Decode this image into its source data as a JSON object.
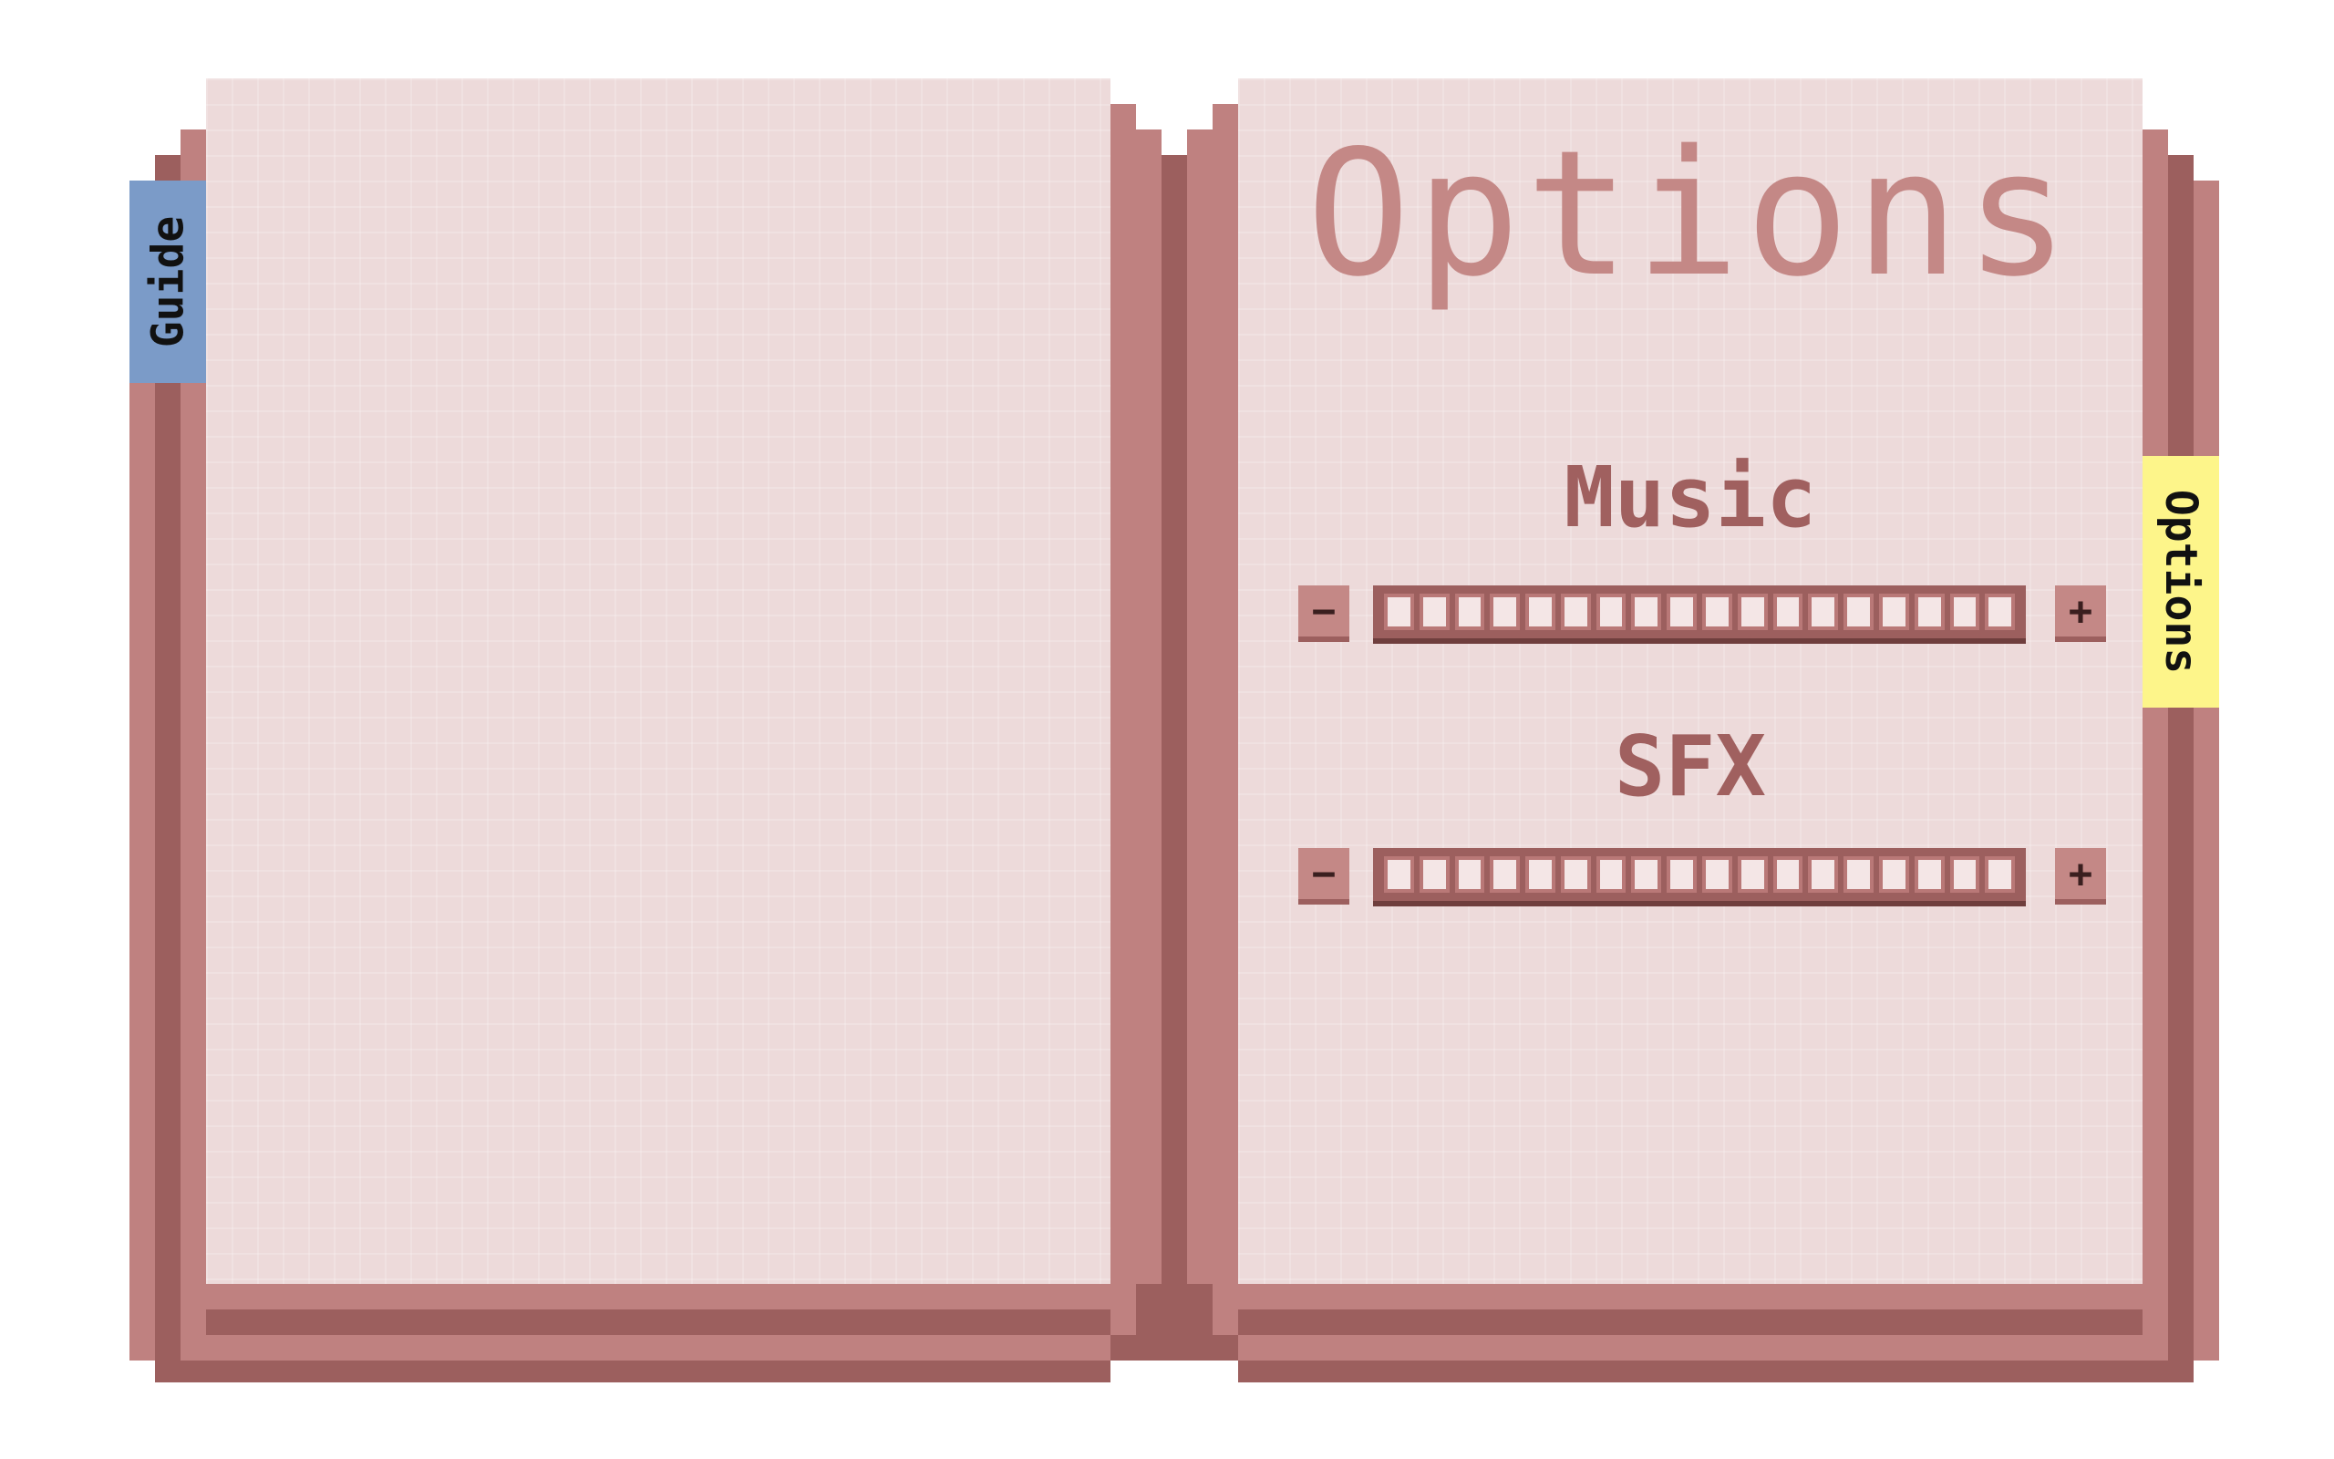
{
  "tabs": {
    "guide": "Guide",
    "options": "Options"
  },
  "right_page": {
    "title": "Options",
    "music": {
      "label": "Music",
      "minus": "−",
      "plus": "+",
      "level": 1.0,
      "segments": 18
    },
    "sfx": {
      "label": "SFX",
      "minus": "−",
      "plus": "+",
      "level": 1.0,
      "segments": 18
    }
  },
  "colors": {
    "page": "#eddada",
    "cover_mid": "#bf8180",
    "cover_dark": "#9c5f5e",
    "guide_tab": "#7b9bc8",
    "options_tab": "#fdf58a",
    "text_title": "#c48886",
    "text_label": "#a0605f"
  }
}
